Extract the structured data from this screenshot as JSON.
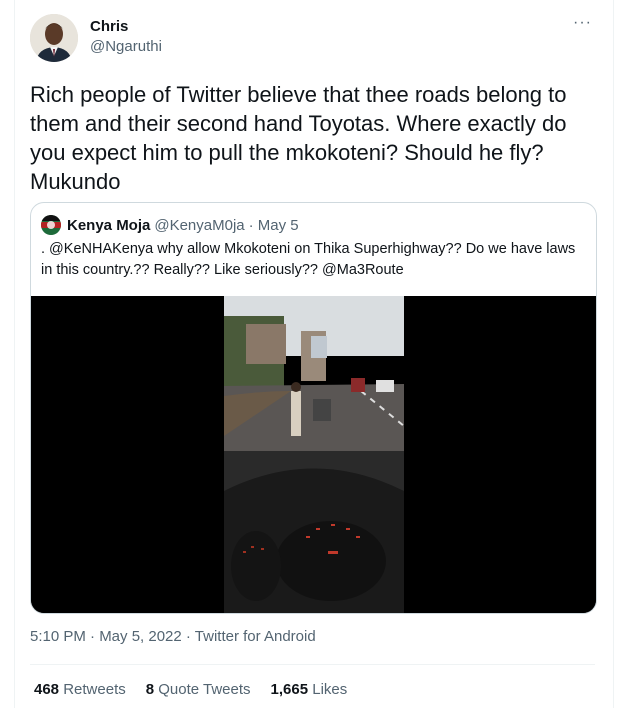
{
  "author": {
    "name": "Chris",
    "handle": "@Ngaruthi"
  },
  "tweet": {
    "text": "Rich people of Twitter believe that thee roads belong to them and their second hand Toyotas. Where exactly do you expect him to pull the mkokoteni? Should he fly? Mukundo"
  },
  "quote": {
    "name": "Kenya Moja",
    "handle": "@KenyaM0ja",
    "date": "· May 5",
    "text": ". @KeNHAKenya why allow Mkokoteni on Thika Superhighway?? Do we have laws in this country.?? Really?? Like seriously?? @Ma3Route"
  },
  "meta": {
    "timestamp": "5:10 PM · May 5, 2022 · Twitter for Android"
  },
  "stats": {
    "retweets_count": "468",
    "retweets_label": "Retweets",
    "quotes_count": "8",
    "quotes_label": "Quote Tweets",
    "likes_count": "1,665",
    "likes_label": "Likes"
  },
  "icons": {
    "more": "more-options-icon"
  }
}
